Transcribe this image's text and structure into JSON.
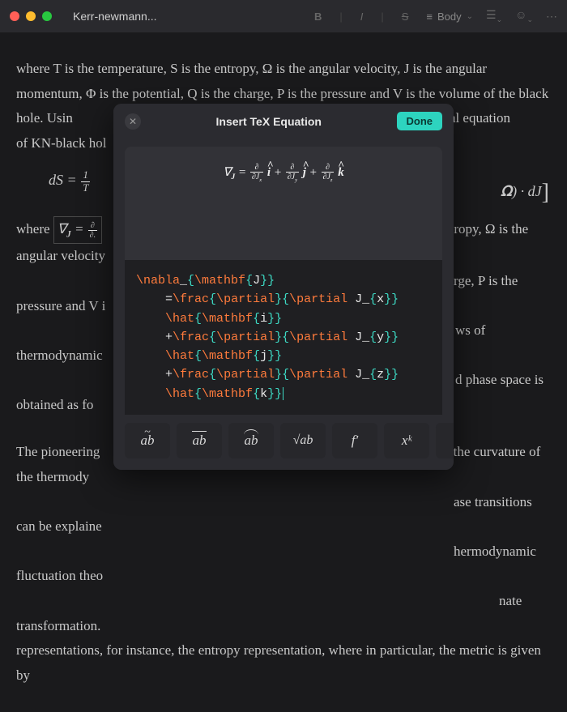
{
  "titlebar": {
    "doc_title": "Kerr-newmann..."
  },
  "toolbar": {
    "bold": "B",
    "italic": "I",
    "strike": "S",
    "body_label": "Body"
  },
  "document": {
    "para1": "where T is the temperature, S is the entropy, Ω is the angular velocity, J is the angular momentum, Φ is the potential, Q is the charge, P is the pressure and V is the volume of the black hole. Usin",
    "para1_tail_a": "ental equation",
    "para1_tail_b": "of KN-black hol",
    "eq1_left": "dS =",
    "eq1_frac_num": "1",
    "eq1_frac_den": "T",
    "right_frag": "𝛀) · dJ",
    "para2_a": "where",
    "para2_boxed": "∇_J =",
    "para2_mid": "ropy, Ω is the angular velocity",
    "para2_mid2": "rge, P is the pressure and V i",
    "para2_mid3": "ws of thermodynamic",
    "para2_mid4": "d phase space is obtained as fo",
    "para3_a": "The pioneering",
    "para3_b": "the curvature of the thermody",
    "para3_c": "ase transitions can be explaine",
    "para3_d": "hermodynamic fluctuation theo",
    "para3_e": "nate transformation.",
    "para3_f": "r, the metric is given by",
    "para3_g": "representations, for instance, the entropy representation, where in particula"
  },
  "modal": {
    "title": "Insert TeX Equation",
    "done": "Done",
    "preview_prefix": "∇",
    "preview_sub": "J",
    "tex_source": "\\nabla_{\\mathbf{J}}\n    =\\frac{\\partial}{\\partial J_{x}}\n    \\hat{\\mathbf{i}}\n    +\\frac{\\partial}{\\partial J_{y}}\n    \\hat{\\mathbf{j}}\n    +\\frac{\\partial}{\\partial J_{z}}\n    \\hat{\\mathbf{k}}"
  },
  "symbols": {
    "tilde": "ab",
    "bar": "ab",
    "hat": "ab",
    "sqrt": "√ab",
    "fprime": "f′",
    "xk": "xᵏ"
  },
  "chart_data": null
}
